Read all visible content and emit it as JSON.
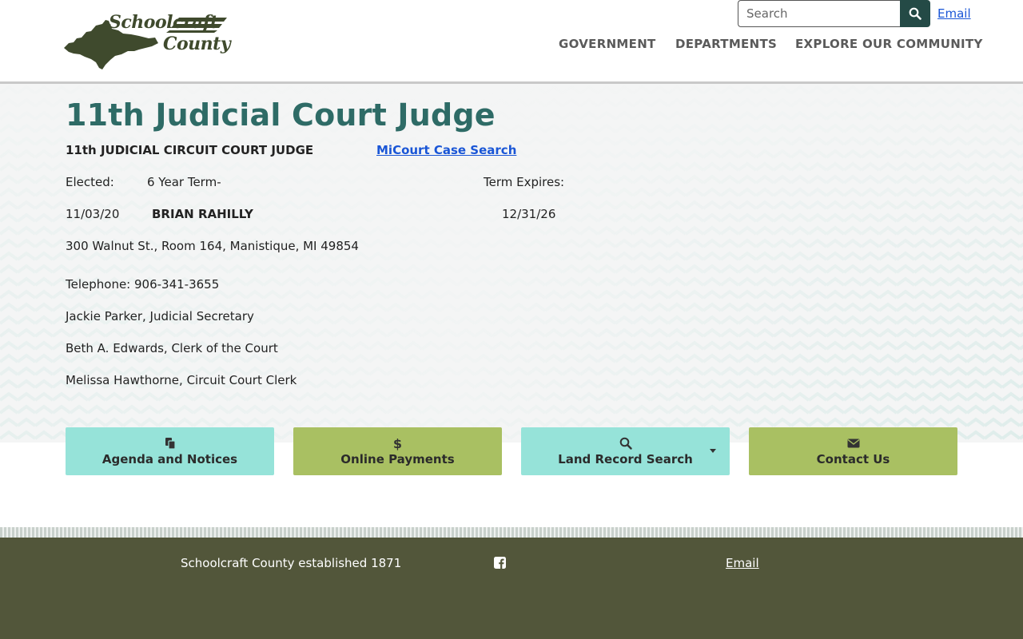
{
  "header": {
    "logo_line1": "Schoolcraft",
    "logo_line2": "County",
    "search_placeholder": "Search",
    "email_link": "Email",
    "nav": [
      "GOVERNMENT",
      "DEPARTMENTS",
      "EXPLORE OUR COMMUNITY"
    ]
  },
  "page": {
    "title": "11th Judicial Court Judge",
    "subtitle": "11th JUDICIAL CIRCUIT COURT JUDGE",
    "case_search_link": "MiCourt Case Search",
    "elected_label": "Elected:",
    "term_label": "6 Year Term-",
    "term_expires_label": "Term Expires:",
    "elected_date": "11/03/20",
    "judge_name": "BRIAN RAHILLY",
    "expires_date": "12/31/26",
    "address": "300 Walnut St., Room 164, Manistique, MI 49854",
    "telephone": "Telephone: 906-341-3655",
    "staff": [
      "Jackie Parker, Judicial Secretary",
      "Beth A. Edwards, Clerk of the Court",
      "Melissa Hawthorne, Circuit Court Clerk"
    ]
  },
  "quick_links": [
    {
      "label": "Agenda and Notices",
      "icon": "copy-icon",
      "color": "#96e3d9"
    },
    {
      "label": "Online Payments",
      "icon": "dollar-icon",
      "color": "#a9c062"
    },
    {
      "label": "Land Record Search",
      "icon": "search-icon",
      "color": "#96e3d9"
    },
    {
      "label": "Contact Us",
      "icon": "envelope-icon",
      "color": "#a9c062"
    }
  ],
  "footer": {
    "established": "Schoolcraft County established 1871",
    "email_link": "Email"
  },
  "colors": {
    "title": "#2e6b66",
    "search_button": "#244a46",
    "footer": "#52563a",
    "link": "#1a56d6"
  }
}
